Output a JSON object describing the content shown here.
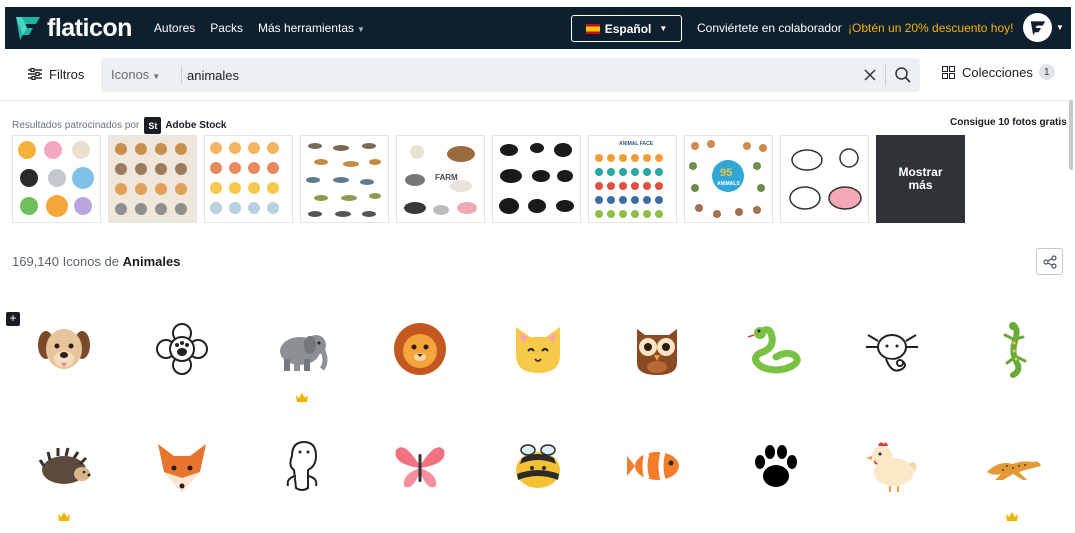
{
  "header": {
    "brand": "flaticon",
    "nav": [
      "Autores",
      "Packs",
      "Más herramientas"
    ],
    "language": "Español",
    "collaborator_link": "Conviértete en colaborador",
    "promo_link": "¡Obtén un 20% descuento hoy!"
  },
  "search": {
    "filters_label": "Filtros",
    "type_label": "Iconos",
    "query": "animales",
    "collections_label": "Colecciones",
    "collections_count": "1"
  },
  "sponsored": {
    "label": "Resultados patrocinados por",
    "stock_logo": "St",
    "stock_name": "Adobe Stock",
    "promo": "Consigue 10 fotos gratis",
    "show_more": "Mostrar más",
    "thumbnails": [
      "animal-set-cartoon",
      "animal-faces-beige",
      "cute-animal-grid",
      "wild-animals-collage",
      "farm-animals",
      "animal-silhouettes",
      "animal-face-circles",
      "95-animals-set",
      "farm-animal-outlines"
    ]
  },
  "results": {
    "count": "169,140",
    "middle": "Iconos de",
    "term": "Animales"
  },
  "icons": [
    {
      "name": "dog-icon",
      "premium": false
    },
    {
      "name": "paw-flower-icon",
      "premium": false
    },
    {
      "name": "elephant-icon",
      "premium": true
    },
    {
      "name": "lion-icon",
      "premium": false
    },
    {
      "name": "cat-icon",
      "premium": false
    },
    {
      "name": "owl-icon",
      "premium": false
    },
    {
      "name": "snake-icon",
      "premium": false
    },
    {
      "name": "axolotl-icon",
      "premium": false
    },
    {
      "name": "lizard-icon",
      "premium": false
    },
    {
      "name": "hedgehog-icon",
      "premium": true
    },
    {
      "name": "fox-icon",
      "premium": false
    },
    {
      "name": "seal-icon",
      "premium": false
    },
    {
      "name": "butterfly-icon",
      "premium": false
    },
    {
      "name": "bee-icon",
      "premium": false
    },
    {
      "name": "clownfish-icon",
      "premium": false
    },
    {
      "name": "paw-print-icon",
      "premium": false
    },
    {
      "name": "chicken-icon",
      "premium": false
    },
    {
      "name": "cheetah-icon",
      "premium": true
    }
  ],
  "colors": {
    "nav_bg": "#0e1f2e",
    "promo": "#f6b500",
    "accent": "#1bb3a2",
    "crown": "#f0b400"
  }
}
